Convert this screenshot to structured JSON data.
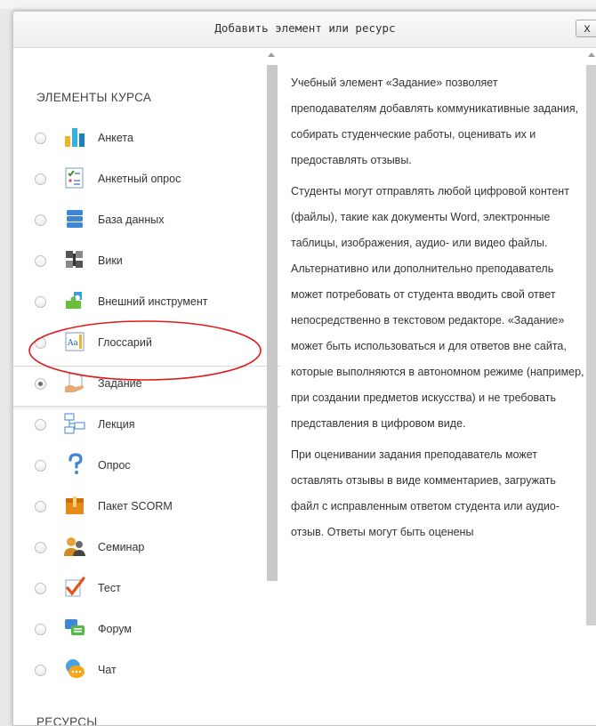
{
  "dialog": {
    "title": "Добавить элемент или ресурс",
    "close_label": "x"
  },
  "activities": {
    "heading": "ЭЛЕМЕНТЫ КУРСА",
    "items": [
      {
        "label": "Анкета",
        "icon": "feedback-chart-icon",
        "selected": false
      },
      {
        "label": "Анкетный опрос",
        "icon": "survey-icon",
        "selected": false
      },
      {
        "label": "База данных",
        "icon": "database-icon",
        "selected": false
      },
      {
        "label": "Вики",
        "icon": "wiki-icon",
        "selected": false
      },
      {
        "label": "Внешний инструмент",
        "icon": "puzzle-icon",
        "selected": false
      },
      {
        "label": "Глоссарий",
        "icon": "glossary-icon",
        "selected": false
      },
      {
        "label": "Задание",
        "icon": "assignment-icon",
        "selected": true
      },
      {
        "label": "Лекция",
        "icon": "lesson-icon",
        "selected": false
      },
      {
        "label": "Опрос",
        "icon": "question-mark-icon",
        "selected": false
      },
      {
        "label": "Пакет SCORM",
        "icon": "scorm-package-icon",
        "selected": false
      },
      {
        "label": "Семинар",
        "icon": "workshop-people-icon",
        "selected": false
      },
      {
        "label": "Тест",
        "icon": "quiz-checkmark-icon",
        "selected": false
      },
      {
        "label": "Форум",
        "icon": "forum-icon",
        "selected": false
      },
      {
        "label": "Чат",
        "icon": "chat-bubble-icon",
        "selected": false
      }
    ]
  },
  "resources": {
    "heading": "РЕСУРСЫ"
  },
  "help": {
    "paragraphs": [
      "Учебный элемент «Задание» позволяет преподавателям добавлять коммуникативные задания, собирать студенческие работы, оценивать их и предоставлять отзывы.",
      "Студенты могут отправлять любой цифровой контент (файлы), такие как документы Word, электронные таблицы, изображения, аудио- или видео файлы. Альтернативно или дополнительно преподаватель может потребовать от студента вводить свой ответ непосредственно в текстовом редакторе. «Задание» может быть использоваться и для ответов вне сайта, которые выполняются в автономном режиме (например, при создании предметов искусства) и не требовать представления в цифровом виде.",
      "При оценивании задания преподаватель может оставлять отзывы в виде комментариев, загружать файл с исправленным ответом студента или аудио-отзыв. Ответы могут быть оценены"
    ]
  },
  "colors": {
    "highlight": "#e01b1b",
    "scroll_thumb": "#c9c9c9"
  }
}
